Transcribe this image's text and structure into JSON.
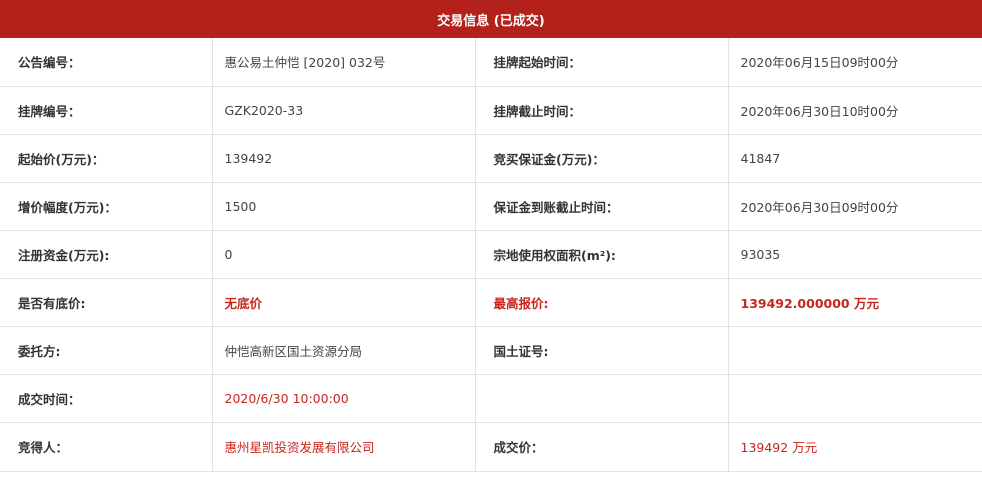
{
  "header": {
    "title": "交易信息 (已成交)"
  },
  "rows": [
    {
      "l1": "公告编号：",
      "v1": "惠公易土仲恺 [2020] 032号",
      "l2": "挂牌起始时间：",
      "v2": "2020年06月15日09时00分"
    },
    {
      "l1": "挂牌编号：",
      "v1": "GZK2020-33",
      "l2": "挂牌截止时间：",
      "v2": "2020年06月30日10时00分"
    },
    {
      "l1": "起始价(万元)：",
      "v1": "139492",
      "l2": "竞买保证金(万元)：",
      "v2": "41847"
    },
    {
      "l1": "增价幅度(万元)：",
      "v1": "1500",
      "l2": "保证金到账截止时间：",
      "v2": "2020年06月30日09时00分"
    },
    {
      "l1": "注册资金(万元):",
      "v1": "0",
      "l2": "宗地使用权面积(m²):",
      "v2": "93035"
    },
    {
      "l1": "是否有底价:",
      "v1": "无底价",
      "l2": "最高报价:",
      "v2": "139492.000000 万元"
    },
    {
      "l1": "委托方:",
      "v1": "仲恺高新区国土资源分局",
      "l2": "国土证号:",
      "v2": ""
    },
    {
      "l1": "成交时间：",
      "v1": "2020/6/30 10:00:00",
      "l2": "",
      "v2": ""
    },
    {
      "l1": "竞得人：",
      "v1": "惠州星凯投资发展有限公司",
      "l2": "成交价：",
      "v2": "139492 万元"
    }
  ],
  "colors": {
    "header_bg": "#b4201a",
    "highlight": "#c8261d"
  }
}
